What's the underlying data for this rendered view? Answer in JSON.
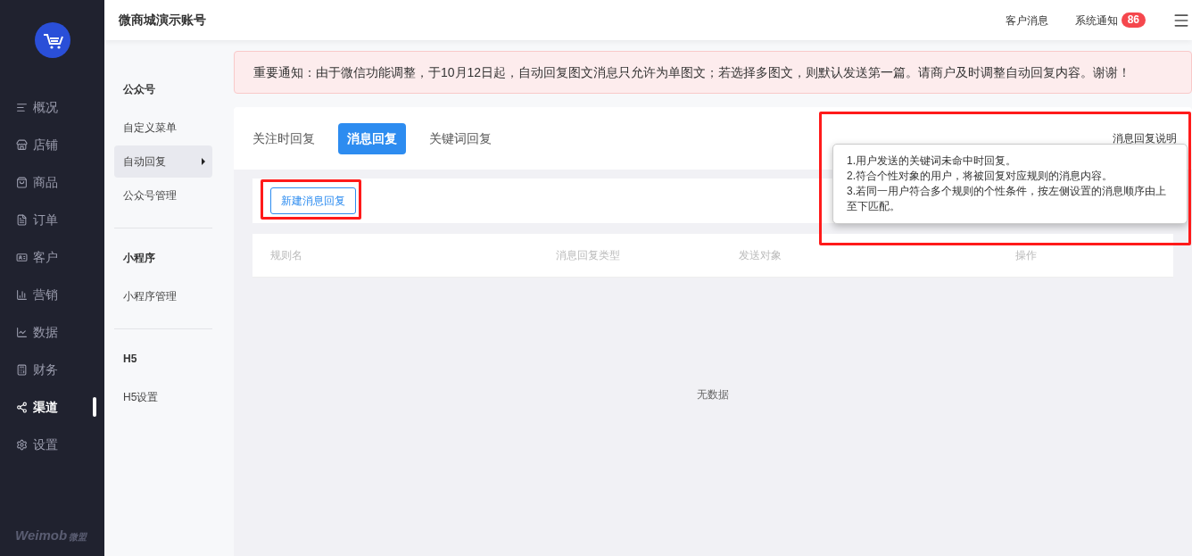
{
  "header": {
    "account": "微商城演示账号",
    "links": [
      {
        "label": "客户消息"
      },
      {
        "label": "系统通知",
        "badge": "86"
      }
    ]
  },
  "sidebar": {
    "items": [
      {
        "label": "概况",
        "selected": false
      },
      {
        "label": "店铺",
        "selected": false
      },
      {
        "label": "商品",
        "selected": false
      },
      {
        "label": "订单",
        "selected": false
      },
      {
        "label": "客户",
        "selected": false
      },
      {
        "label": "营销",
        "selected": false
      },
      {
        "label": "数据",
        "selected": false
      },
      {
        "label": "财务",
        "selected": false
      },
      {
        "label": "渠道",
        "selected": true
      },
      {
        "label": "设置",
        "selected": false
      }
    ],
    "brand": "Weimob",
    "brand_cn": "微盟"
  },
  "subnav": [
    {
      "title": "公众号",
      "items": [
        {
          "label": "自定义菜单",
          "selected": false
        },
        {
          "label": "自动回复",
          "selected": true
        },
        {
          "label": "公众号管理",
          "selected": false
        }
      ]
    },
    {
      "title": "小程序",
      "items": [
        {
          "label": "小程序管理",
          "selected": false
        }
      ]
    },
    {
      "title": "H5",
      "items": [
        {
          "label": "H5设置",
          "selected": false
        }
      ]
    }
  ],
  "notice": "重要通知：由于微信功能调整，于10月12日起，自动回复图文消息只允许为单图文；若选择多图文，则默认发送第一篇。请商户及时调整自动回复内容。谢谢！",
  "tabs": [
    {
      "label": "关注时回复",
      "selected": false
    },
    {
      "label": "消息回复",
      "selected": true
    },
    {
      "label": "关键词回复",
      "selected": false
    }
  ],
  "help_link": "消息回复说明",
  "tooltip": [
    "1.用户发送的关键词未命中时回复。",
    "2.符合个性对象的用户，将被回复对应规则的消息内容。",
    "3.若同一用户符合多个规则的个性条件，按左侧设置的消息顺序由上至下匹配。"
  ],
  "new_button": "新建消息回复",
  "table": {
    "columns": [
      "规则名",
      "消息回复类型",
      "发送对象",
      "操作"
    ],
    "empty_text": "无数据"
  },
  "highlights": {
    "new_button": true,
    "help_area": true
  }
}
